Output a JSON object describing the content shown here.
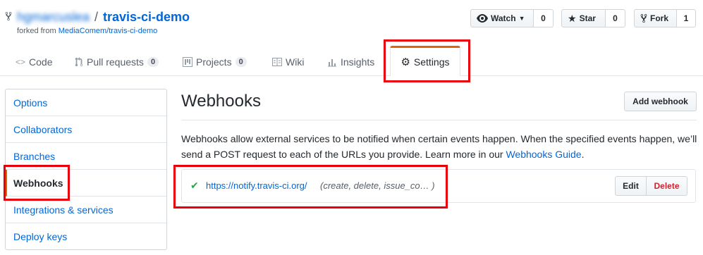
{
  "header": {
    "owner": "hgmarcuslea",
    "separator": "/",
    "repo_name": "travis-ci-demo",
    "forked_prefix": "forked from",
    "forked_from": "MediaComem/travis-ci-demo"
  },
  "actions": {
    "watch_label": "Watch",
    "watch_count": "0",
    "star_label": "Star",
    "star_count": "0",
    "fork_label": "Fork",
    "fork_count": "1"
  },
  "tabs": [
    {
      "label": "Code"
    },
    {
      "label": "Pull requests",
      "count": "0"
    },
    {
      "label": "Projects",
      "count": "0"
    },
    {
      "label": "Wiki"
    },
    {
      "label": "Insights"
    },
    {
      "label": "Settings",
      "selected": true
    }
  ],
  "sidebar": {
    "items": [
      {
        "label": "Options"
      },
      {
        "label": "Collaborators"
      },
      {
        "label": "Branches"
      },
      {
        "label": "Webhooks",
        "selected": true
      },
      {
        "label": "Integrations & services"
      },
      {
        "label": "Deploy keys"
      }
    ]
  },
  "main": {
    "title": "Webhooks",
    "add_button": "Add webhook",
    "description": "Webhooks allow external services to be notified when certain events happen. When the specified events happen, we’ll send a POST request to each of the URLs you provide. Learn more in our",
    "guide_link": "Webhooks Guide",
    "period": ".",
    "hooks": [
      {
        "status_icon": "check-icon",
        "url": "https://notify.travis-ci.org/",
        "events": "(create, delete, issue_co… )",
        "edit_label": "Edit",
        "delete_label": "Delete"
      }
    ]
  },
  "colors": {
    "accent": "#0366d6",
    "selected_tab_border": "#e36209",
    "highlight": "#e8000b",
    "success": "#28a745",
    "danger": "#cb2431"
  }
}
